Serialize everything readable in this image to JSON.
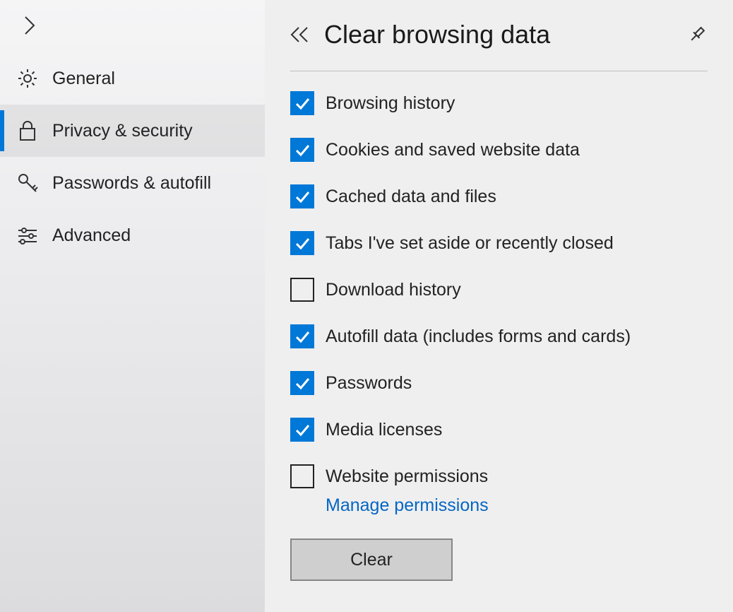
{
  "sidebar": {
    "items": [
      {
        "label": "General",
        "active": false
      },
      {
        "label": "Privacy & security",
        "active": true
      },
      {
        "label": "Passwords & autofill",
        "active": false
      },
      {
        "label": "Advanced",
        "active": false
      }
    ]
  },
  "panel": {
    "title": "Clear browsing data",
    "options": [
      {
        "label": "Browsing history",
        "checked": true
      },
      {
        "label": "Cookies and saved website data",
        "checked": true
      },
      {
        "label": "Cached data and files",
        "checked": true
      },
      {
        "label": "Tabs I've set aside or recently closed",
        "checked": true
      },
      {
        "label": "Download history",
        "checked": false
      },
      {
        "label": "Autofill data (includes forms and cards)",
        "checked": true
      },
      {
        "label": "Passwords",
        "checked": true
      },
      {
        "label": "Media licenses",
        "checked": true
      },
      {
        "label": "Website permissions",
        "checked": false,
        "sub_link": "Manage permissions"
      }
    ],
    "clear_button": "Clear"
  }
}
